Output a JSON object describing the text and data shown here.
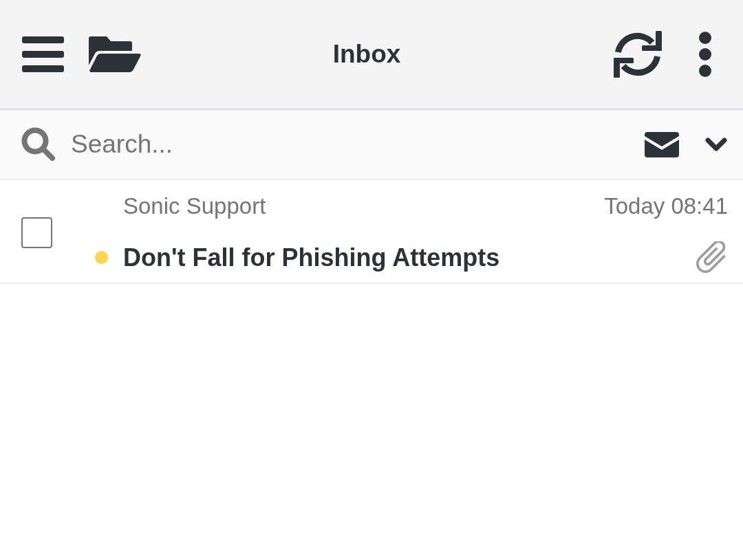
{
  "header": {
    "title": "Inbox"
  },
  "search": {
    "placeholder": "Search..."
  },
  "messages": [
    {
      "sender": "Sonic Support",
      "date": "Today 08:41",
      "subject": "Don't Fall for Phishing Attempts",
      "checked": false,
      "unread": true,
      "attachment": true
    }
  ]
}
